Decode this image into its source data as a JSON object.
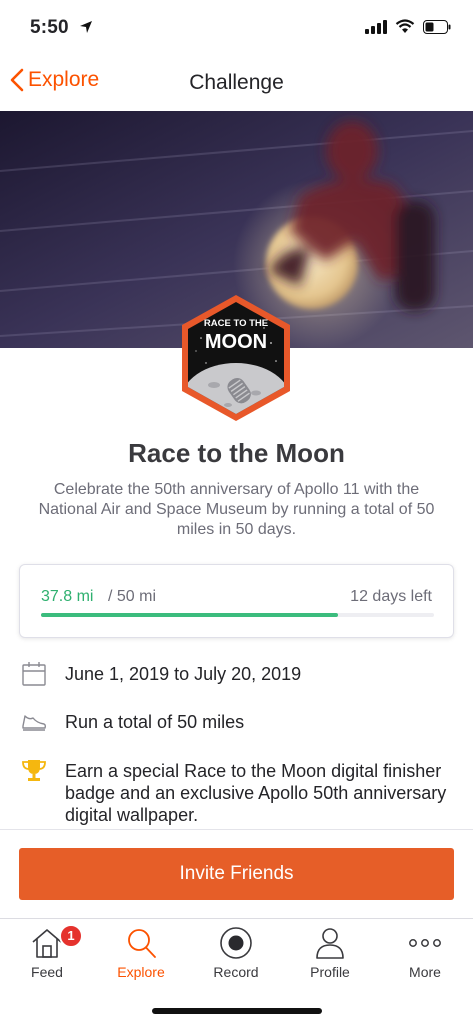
{
  "status_bar": {
    "time": "5:50"
  },
  "nav": {
    "back_label": "Explore",
    "title": "Challenge"
  },
  "challenge": {
    "badge_text_top": "RACE TO THE",
    "badge_text_main": "MOON",
    "title": "Race to the Moon",
    "description": "Celebrate the 50th anniversary of Apollo 11 with the National Air and Space Museum by running a total of 50 miles in 50 days."
  },
  "progress": {
    "current": "37.8 mi",
    "total": "/ 50 mi",
    "remaining": "12 days left",
    "fraction": 0.756
  },
  "details": [
    {
      "icon": "calendar-icon",
      "text": "June 1, 2019 to July 20, 2019"
    },
    {
      "icon": "shoe-icon",
      "text": "Run a total of 50 miles"
    },
    {
      "icon": "trophy-icon",
      "text": "Earn a special Race to the Moon digital finisher badge and an exclusive Apollo 50th anniversary digital wallpaper."
    }
  ],
  "invite_label": "Invite Friends",
  "tabs": [
    {
      "label": "Feed",
      "icon": "home-icon",
      "badge": "1"
    },
    {
      "label": "Explore",
      "icon": "search-icon",
      "active": true
    },
    {
      "label": "Record",
      "icon": "record-icon"
    },
    {
      "label": "Profile",
      "icon": "profile-icon"
    },
    {
      "label": "More",
      "icon": "more-icon"
    }
  ],
  "colors": {
    "accent": "#fc5200",
    "button": "#e65e28",
    "progress": "#3bbc7d",
    "badge": "#e5322d"
  }
}
